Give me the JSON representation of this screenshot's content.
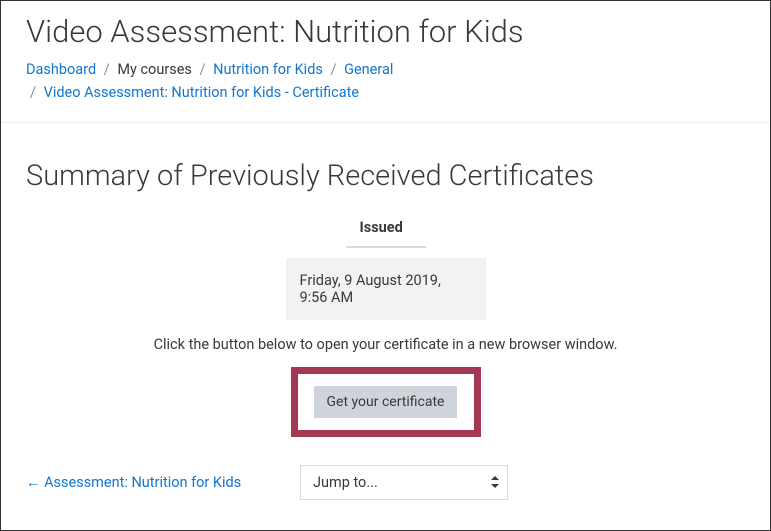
{
  "page": {
    "title": "Video Assessment: Nutrition for Kids"
  },
  "breadcrumb": {
    "items": [
      {
        "label": "Dashboard",
        "link": true
      },
      {
        "label": "My courses",
        "link": false
      },
      {
        "label": "Nutrition for Kids",
        "link": true
      },
      {
        "label": "General",
        "link": true
      },
      {
        "label": "Video Assessment: Nutrition for Kids - Certificate",
        "link": true
      }
    ]
  },
  "section": {
    "title": "Summary of Previously Received Certificates",
    "table": {
      "header": "Issued",
      "value": "Friday, 9 August 2019, 9:56 AM"
    },
    "instruction": "Click the button below to open your certificate in a new browser window.",
    "button_label": "Get your certificate"
  },
  "footer": {
    "prev_label": "← Assessment: Nutrition for Kids",
    "jump_label": "Jump to..."
  }
}
